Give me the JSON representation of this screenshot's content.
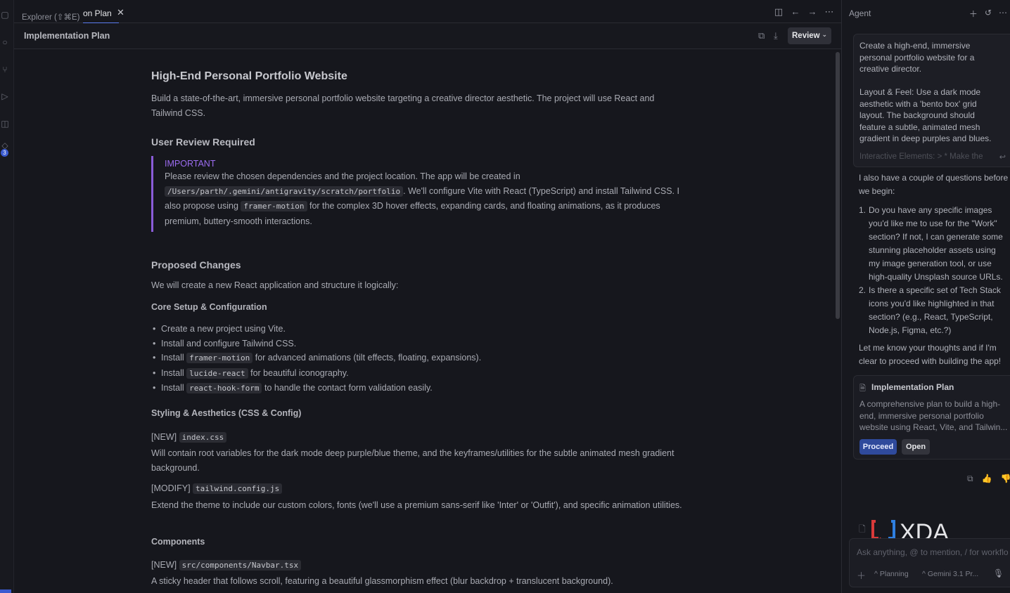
{
  "tabs": {
    "explorer": "Explorer (⇧⌘E)",
    "active": "on Plan",
    "close": "✕"
  },
  "document": {
    "header_title": "Implementation Plan",
    "review_label": "Review",
    "title": "High-End Personal Portfolio Website",
    "intro": "Build a state-of-the-art, immersive personal portfolio website targeting a creative director aesthetic. The project will use React and Tailwind CSS.",
    "review_heading": "User Review Required",
    "callout_label": "IMPORTANT",
    "callout_text_1": "Please review the chosen dependencies and the project location. The app will be created in",
    "callout_path": "/Users/parth/.gemini/antigravity/scratch/portfolio",
    "callout_text_2": ". We'll configure Vite with React (TypeScript) and install Tailwind CSS. I also propose using",
    "callout_code": "framer-motion",
    "callout_text_3": "for the complex 3D hover effects, expanding cards, and floating animations, as it produces premium, buttery-smooth interactions.",
    "changes_heading": "Proposed Changes",
    "changes_intro": "We will create a new React application and structure it logically:",
    "core_heading": "Core Setup & Configuration",
    "core_items": [
      {
        "pre": "Create a new project using Vite.",
        "code": "",
        "post": ""
      },
      {
        "pre": "Install and configure Tailwind CSS.",
        "code": "",
        "post": ""
      },
      {
        "pre": "Install",
        "code": "framer-motion",
        "post": "for advanced animations (tilt effects, floating, expansions)."
      },
      {
        "pre": "Install",
        "code": "lucide-react",
        "post": "for beautiful iconography."
      },
      {
        "pre": "Install",
        "code": "react-hook-form",
        "post": "to handle the contact form validation easily."
      }
    ],
    "styling_heading": "Styling & Aesthetics (CSS & Config)",
    "new_tag": "[NEW]",
    "modify_tag": "[MODIFY]",
    "index_file": "index.css",
    "index_desc": "Will contain root variables for the dark mode deep purple/blue theme, and the keyframes/utilities for the subtle animated mesh gradient background.",
    "tailwind_file": "tailwind.config.js",
    "tailwind_desc": "Extend the theme to include our custom colors, fonts (we'll use a premium sans-serif like 'Inter' or 'Outfit'), and specific animation utilities.",
    "components_heading": "Components",
    "navbar_file": "src/components/Navbar.tsx",
    "navbar_desc": "A sticky header that follows scroll, featuring a beautiful glassmorphism effect (blur backdrop + translucent background)."
  },
  "agent": {
    "title": "Agent",
    "prompt_text": "Create a high-end, immersive personal portfolio website for a creative director.\n\nLayout & Feel: Use a dark mode aesthetic with a 'bento box' grid layout. The background should feature a subtle, animated mesh gradient in deep purples and blues.",
    "prompt_fade": "Interactive Elements: > * Make the",
    "reply_intro": "I also have a couple of questions before we begin:",
    "questions": [
      {
        "num": "1.",
        "text": "Do you have any specific images you'd like me to use for the \"Work\" section? If not, I can generate some stunning placeholder assets using my image generation tool, or use high-quality Unsplash source URLs."
      },
      {
        "num": "2.",
        "text": "Is there a specific set of Tech Stack icons you'd like highlighted in that section? (e.g., React, TypeScript, Node.js, Figma, etc.?)"
      }
    ],
    "closing": "Let me know your thoughts and if I'm clear to proceed with building the app!",
    "plan_title": "Implementation Plan",
    "plan_desc": "A comprehensive plan to build a high-end, immersive personal portfolio website using React, Vite, and Tailwin...",
    "proceed_label": "Proceed",
    "open_label": "Open",
    "input_placeholder": "Ask anything, @ to mention, / for workflo",
    "mode_label": "Planning",
    "model_label": "Gemini 3.1 Pr...",
    "watermark": "XDA",
    "activity_badge": "3"
  },
  "colors": {
    "accent": "#5b7cf0",
    "important": "#9c6cf0",
    "proceed": "#2f4a9c"
  }
}
